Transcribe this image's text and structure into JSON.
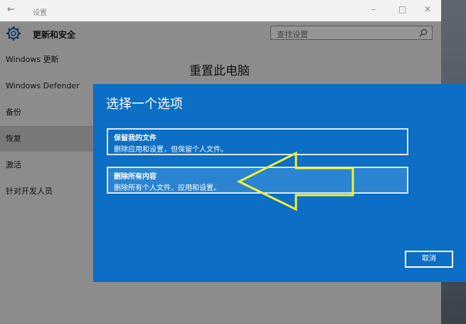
{
  "window": {
    "title": "设置",
    "back_symbol": "←",
    "minimize_symbol": "–",
    "maximize_symbol": "□",
    "close_symbol": "✕"
  },
  "sidebar": {
    "header_label": "更新和安全",
    "items": [
      {
        "label": "Windows 更新",
        "selected": false
      },
      {
        "label": "Windows Defender",
        "selected": false
      },
      {
        "label": "备份",
        "selected": false
      },
      {
        "label": "恢复",
        "selected": true
      },
      {
        "label": "激活",
        "selected": false
      },
      {
        "label": "针对开发人员",
        "selected": false
      }
    ]
  },
  "search": {
    "placeholder": "查找设置",
    "icon": "search-icon"
  },
  "main": {
    "title": "重置此电脑"
  },
  "dialog": {
    "title": "选择一个选项",
    "options": [
      {
        "title": "保留我的文件",
        "description": "删除应用和设置，但保留个人文件。"
      },
      {
        "title": "删除所有内容",
        "description": "删除所有个人文件、应用和设置。"
      }
    ],
    "cancel_label": "取消"
  },
  "annotation": {
    "type": "arrow",
    "color": "#f2ef3a",
    "points_to": "删除所有内容"
  },
  "colors": {
    "dialog_bg": "#0c6ec4",
    "selected_nav_bg": "#cfcfcf",
    "window_bg": "#f2f2f2"
  }
}
